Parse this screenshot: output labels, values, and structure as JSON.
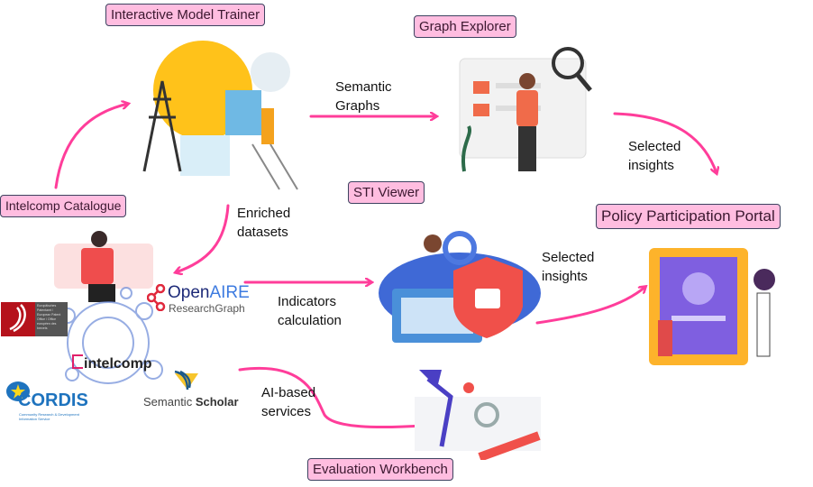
{
  "modules": {
    "model_trainer": "Interactive Model Trainer",
    "graph_explorer": "Graph Explorer",
    "sti_viewer": "STI Viewer",
    "catalogue": "Intelcomp Catalogue",
    "policy_portal": "Policy Participation Portal",
    "evaluation_workbench": "Evaluation Workbench"
  },
  "flows": {
    "semantic_graphs": "Semantic\nGraphs",
    "enriched_datasets": "Enriched\ndatasets",
    "indicators": "Indicators\ncalculation",
    "ai_services": "AI-based\nservices",
    "selected_insights_1": "Selected\ninsights",
    "selected_insights_2": "Selected\ninsights"
  },
  "logos": {
    "openaire_1": "Open",
    "openaire_2": "AIRE",
    "openaire_sub": "ResearchGraph",
    "epo": "Europäisches Patentamt / European Patent Office / Office européen des brevets",
    "intelcomp": "intelcomp",
    "cordis": "CORDIS",
    "cordis_sub": "Community Research & Development Information Service",
    "semantic_1": "Semantic",
    "semantic_2": "Scholar"
  },
  "colors": {
    "arrow": "#ff3d9a",
    "label_bg": "#ffbde0",
    "label_border": "#3d4260"
  }
}
